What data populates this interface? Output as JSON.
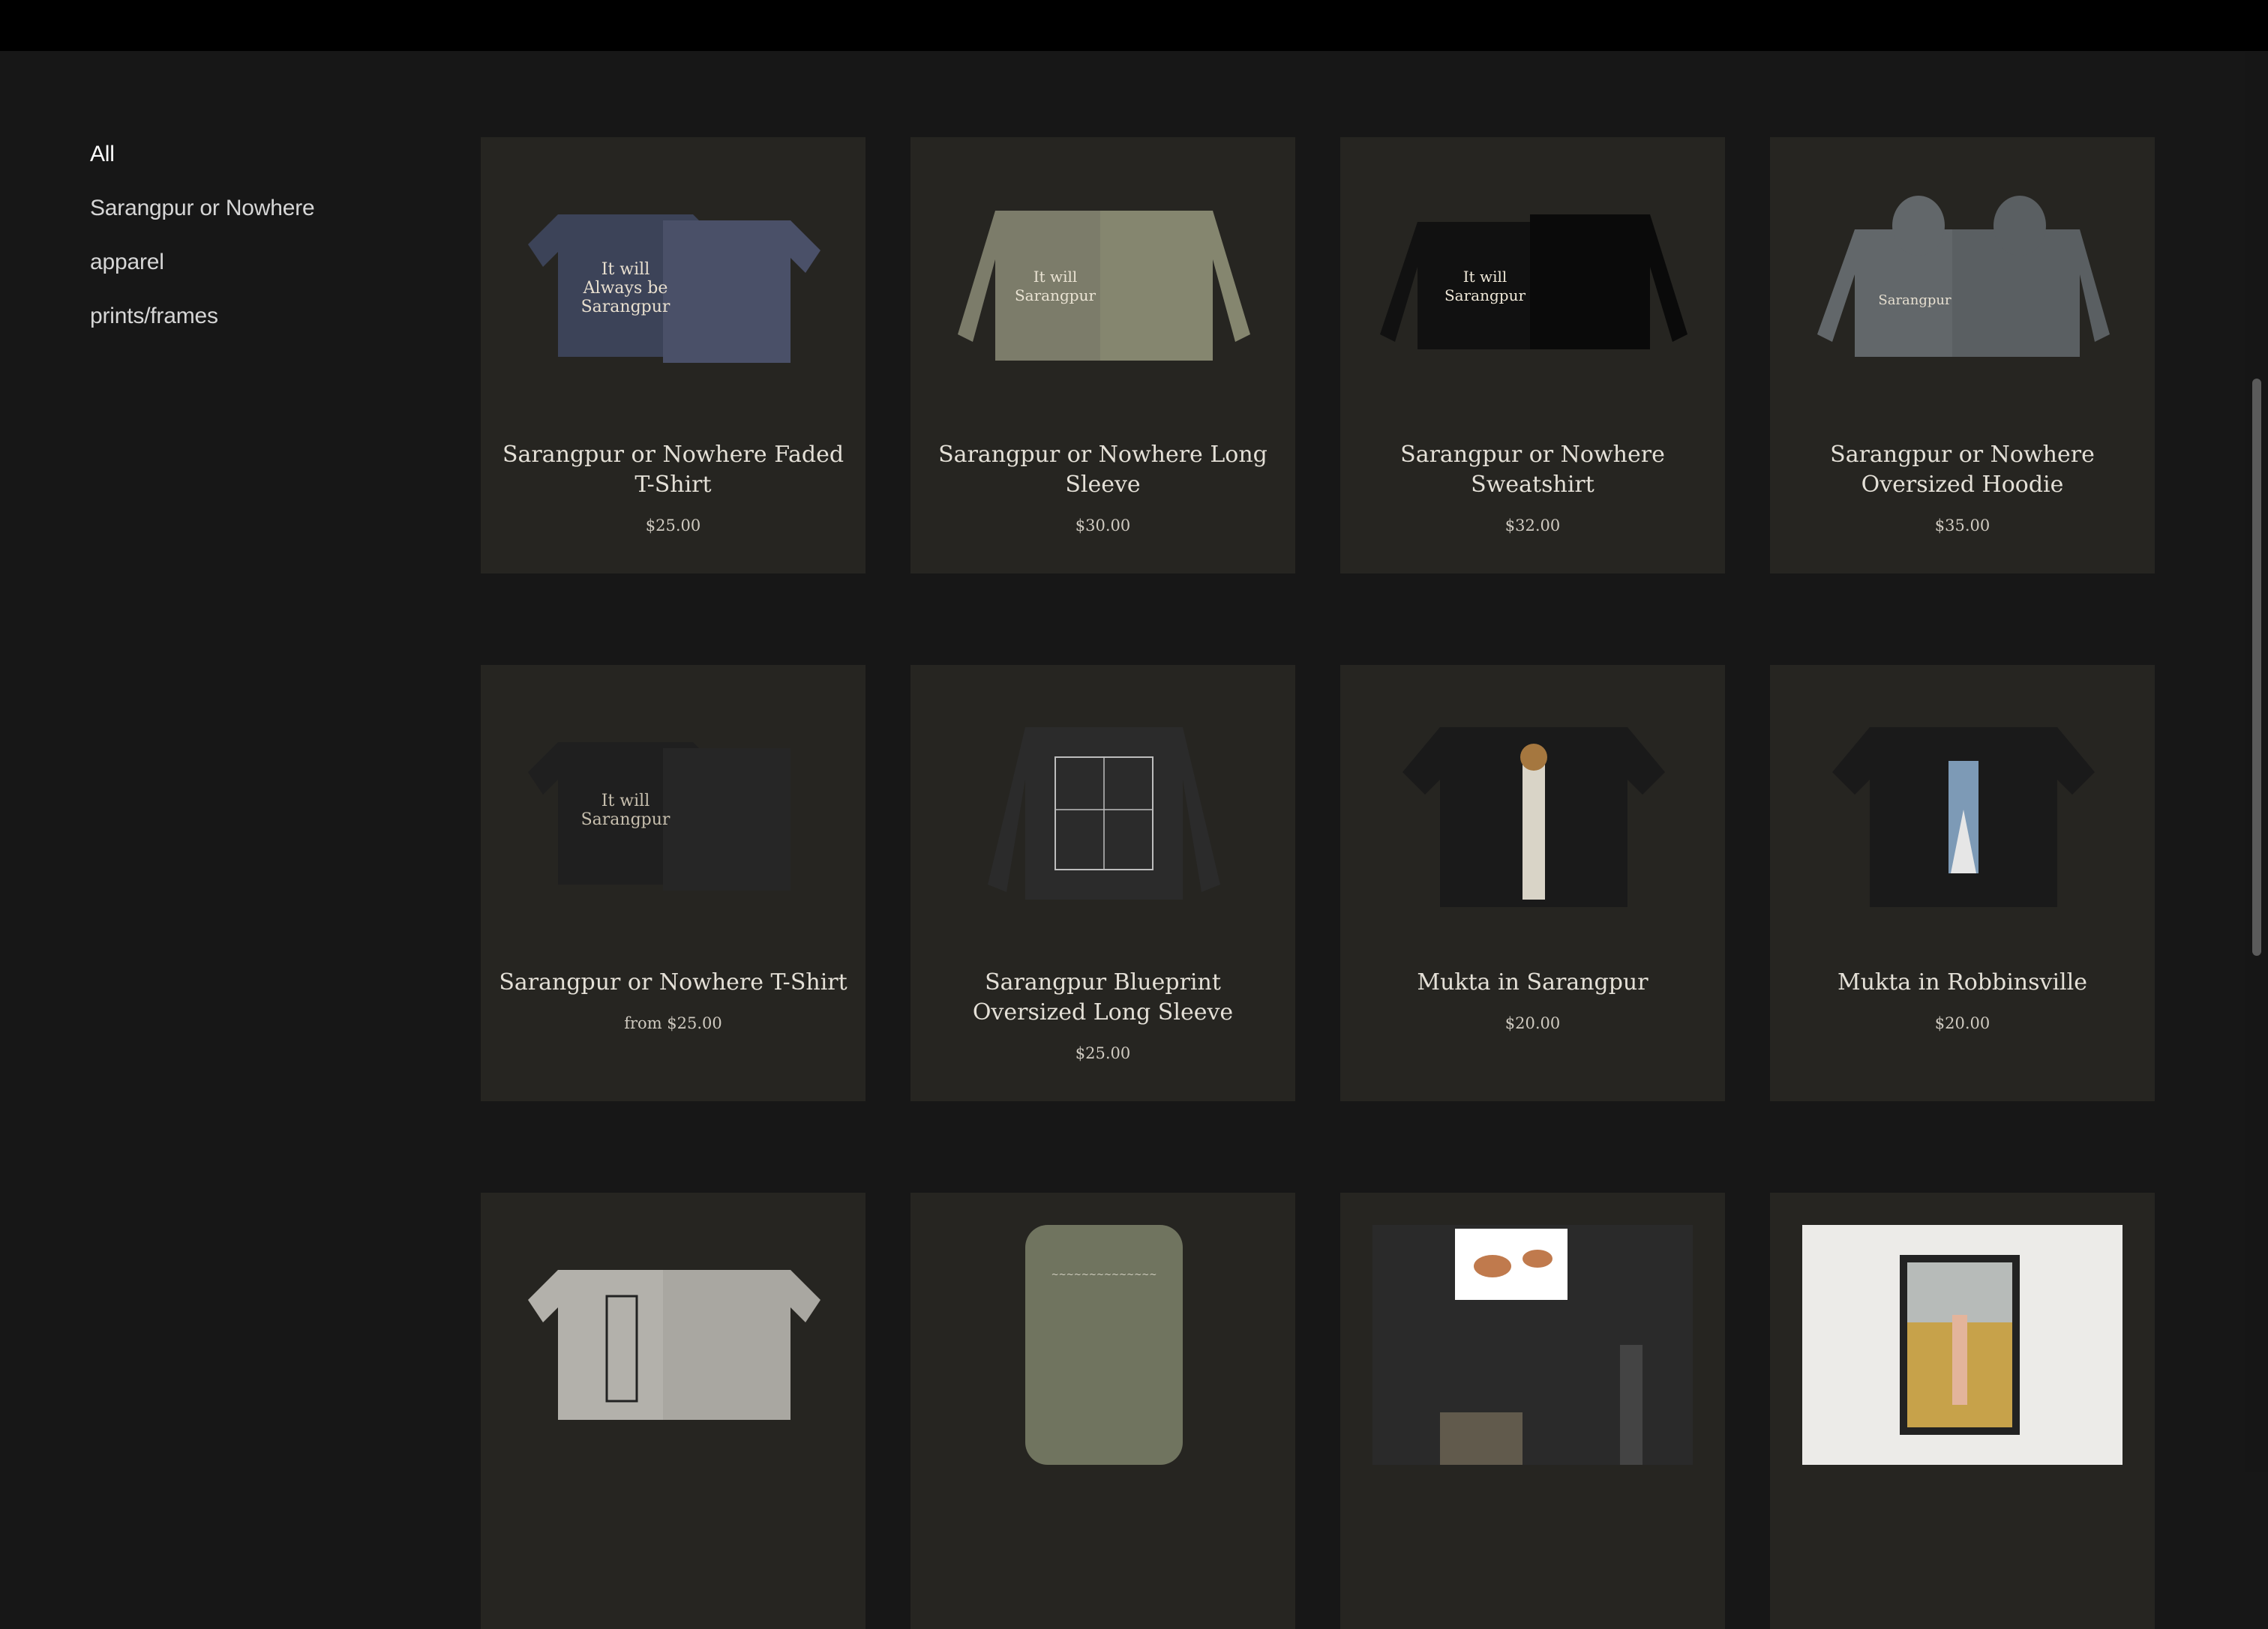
{
  "sidebar": {
    "categories": [
      {
        "label": "All",
        "active": true
      },
      {
        "label": "Sarangpur or Nowhere",
        "active": false
      },
      {
        "label": "apparel",
        "active": false
      },
      {
        "label": "prints/frames",
        "active": false
      }
    ]
  },
  "products": [
    {
      "name": "Sarangpur or Nowhere Faded T-Shirt",
      "price": "$25.00",
      "image": "tshirt-pair",
      "color": "#3c4358"
    },
    {
      "name": "Sarangpur or Nowhere Long Sleeve",
      "price": "$30.00",
      "image": "longsleeve-pair",
      "color": "#7c7c6a"
    },
    {
      "name": "Sarangpur or Nowhere Sweatshirt",
      "price": "$32.00",
      "image": "sweatshirt-pair",
      "color": "#111111"
    },
    {
      "name": "Sarangpur or Nowhere Oversized Hoodie",
      "price": "$35.00",
      "image": "hoodie-pair",
      "color": "#62676a"
    },
    {
      "name": "Sarangpur or Nowhere T-Shirt",
      "price": "from $25.00",
      "image": "tshirt-pair",
      "color": "#1f1f1f"
    },
    {
      "name": "Sarangpur Blueprint Oversized Long Sleeve",
      "price": "$25.00",
      "image": "blueprint-longsleeve",
      "color": "#2b2b2b"
    },
    {
      "name": "Mukta in Sarangpur",
      "price": "$20.00",
      "image": "tshirt-back-photo",
      "color": "#1a1a1a"
    },
    {
      "name": "Mukta in Robbinsville",
      "price": "$20.00",
      "image": "tshirt-back-photo-sky",
      "color": "#1a1a1a"
    },
    {
      "name": "",
      "price": "",
      "image": "tshirt-grey-pair",
      "color": "#b3b1ab"
    },
    {
      "name": "",
      "price": "",
      "image": "longsleeve-olive",
      "color": "#70745f"
    },
    {
      "name": "",
      "price": "",
      "image": "wall-print-wood",
      "color": "#2a2a2a"
    },
    {
      "name": "",
      "price": "",
      "image": "framed-print-brick",
      "color": "#ecebe8"
    }
  ]
}
